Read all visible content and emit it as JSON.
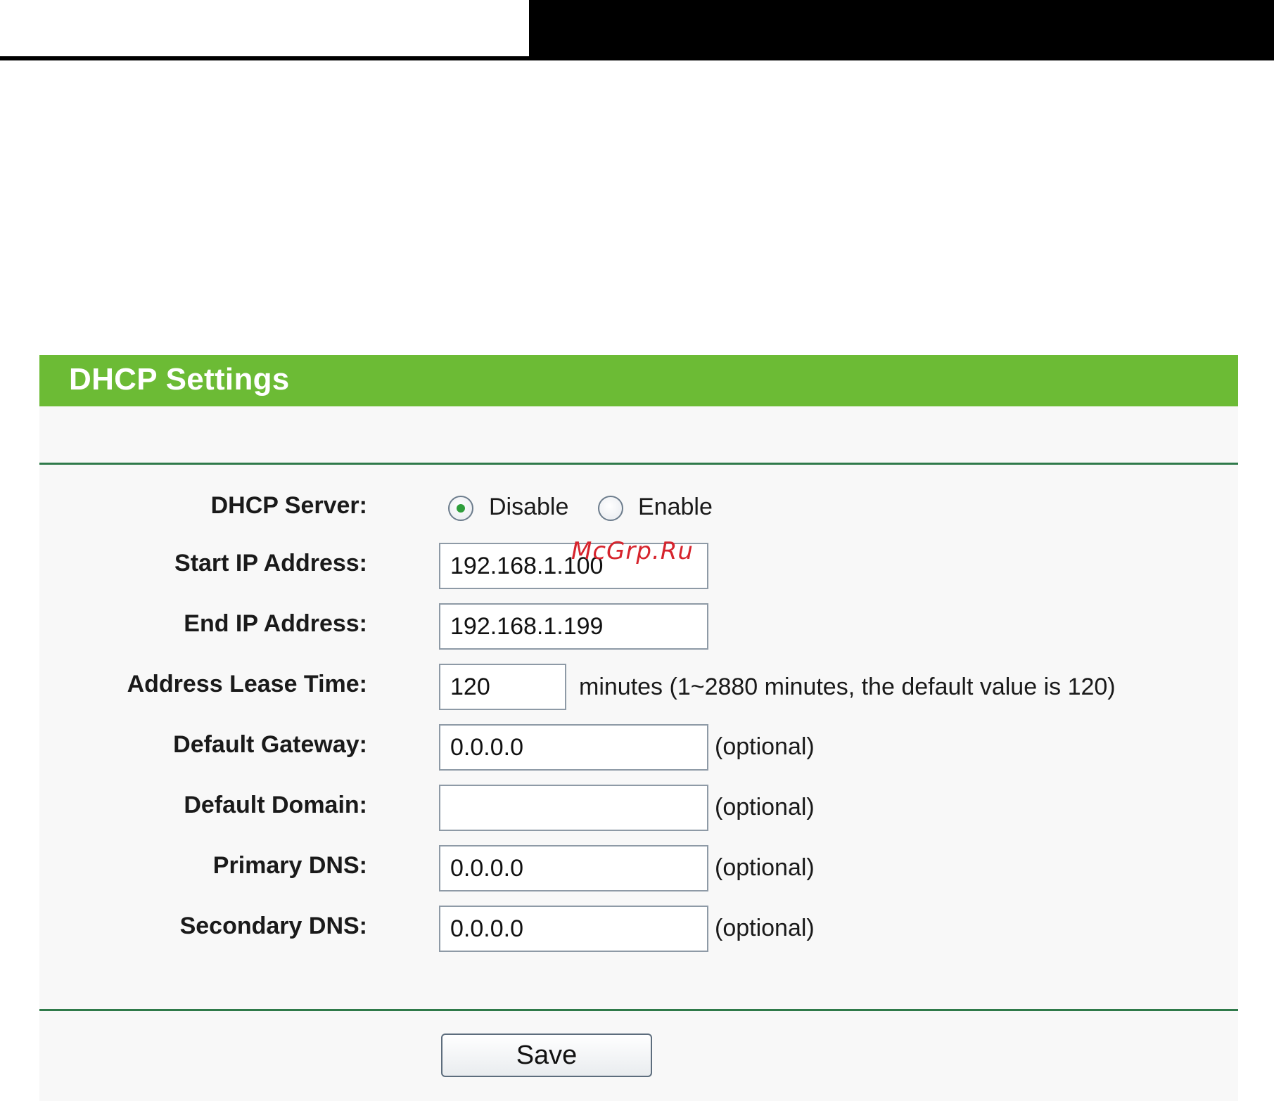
{
  "header": {
    "title": "DHCP Settings"
  },
  "form": {
    "dhcp_server": {
      "label": "DHCP Server:",
      "options": [
        {
          "label": "Disable",
          "selected": true
        },
        {
          "label": "Enable",
          "selected": false
        }
      ]
    },
    "start_ip": {
      "label": "Start IP Address:",
      "value": "192.168.1.100"
    },
    "end_ip": {
      "label": "End IP Address:",
      "value": "192.168.1.199"
    },
    "lease_time": {
      "label": "Address Lease Time:",
      "value": "120",
      "hint": "minutes (1~2880 minutes, the default value is 120)"
    },
    "default_gateway": {
      "label": "Default Gateway:",
      "value": "0.0.0.0",
      "hint": "(optional)"
    },
    "default_domain": {
      "label": "Default Domain:",
      "value": "",
      "hint": "(optional)"
    },
    "primary_dns": {
      "label": "Primary DNS:",
      "value": "0.0.0.0",
      "hint": "(optional)"
    },
    "secondary_dns": {
      "label": "Secondary DNS:",
      "value": "0.0.0.0",
      "hint": "(optional)"
    }
  },
  "actions": {
    "save_label": "Save"
  },
  "watermark": {
    "text": "McGrp.Ru"
  },
  "colors": {
    "header_green": "#6cbb35",
    "divider_green": "#2f7a4a",
    "panel_background": "#f8f8f8",
    "radio_selected": "#2f9e3c",
    "watermark_red": "#d6242d"
  }
}
